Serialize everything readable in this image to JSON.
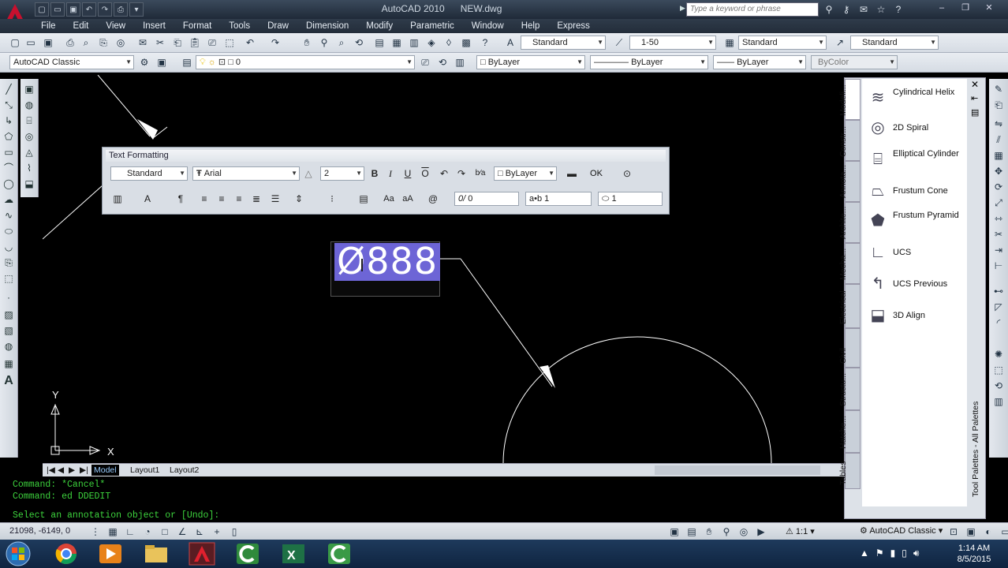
{
  "window": {
    "title": "AutoCAD 2010",
    "file": "NEW.dwg",
    "search_placeholder": "Type a keyword or phrase"
  },
  "menu": [
    "File",
    "Edit",
    "View",
    "Insert",
    "Format",
    "Tools",
    "Draw",
    "Dimension",
    "Modify",
    "Parametric",
    "Window",
    "Help",
    "Express"
  ],
  "toolbar1": {
    "text_style": "Standard",
    "dim_scale": "1-50",
    "dim_style": "Standard",
    "table_style": "Standard"
  },
  "toolbar2": {
    "workspace": "AutoCAD Classic",
    "layer": "0",
    "color": "ByLayer",
    "linetype": "ByLayer",
    "lineweight": "ByLayer",
    "plotstyle": "ByColor"
  },
  "text_formatting": {
    "title": "Text Formatting",
    "style": "Standard",
    "font": "Arial",
    "height": "2",
    "color": "ByLayer",
    "ok_label": "OK",
    "oblique": "0",
    "tracking": "1",
    "width": "1"
  },
  "mtext": {
    "value": "Ø888"
  },
  "layout_tabs": [
    "Model",
    "Layout1",
    "Layout2"
  ],
  "command_lines": [
    "Command: *Cancel*",
    "Command: ed DDEDIT",
    "Select an annotation object or [Undo]:"
  ],
  "status": {
    "coords": "21098, -6149, 0",
    "annotation_scale": "1:1",
    "workspace": "AutoCAD Classic"
  },
  "palette": {
    "tabs": [
      "Modeli...",
      "Constr...",
      "Annota...",
      "Archite...",
      "Mecha...",
      "Electrical",
      "Civil",
      "Structu...",
      "Hatche...",
      "Tables"
    ],
    "items": [
      "Cylindrical Helix",
      "2D Spiral",
      "Elliptical Cylinder",
      "Frustum Cone",
      "Frustum Pyramid",
      "UCS",
      "UCS Previous",
      "3D Align"
    ],
    "side_label": "Tool Palettes - All Palettes"
  },
  "clock": {
    "time": "1:14 AM",
    "date": "8/5/2015"
  },
  "colors": {
    "selection": "#6d65d6",
    "command_text": "#3dd33d",
    "canvas": "#000000"
  }
}
